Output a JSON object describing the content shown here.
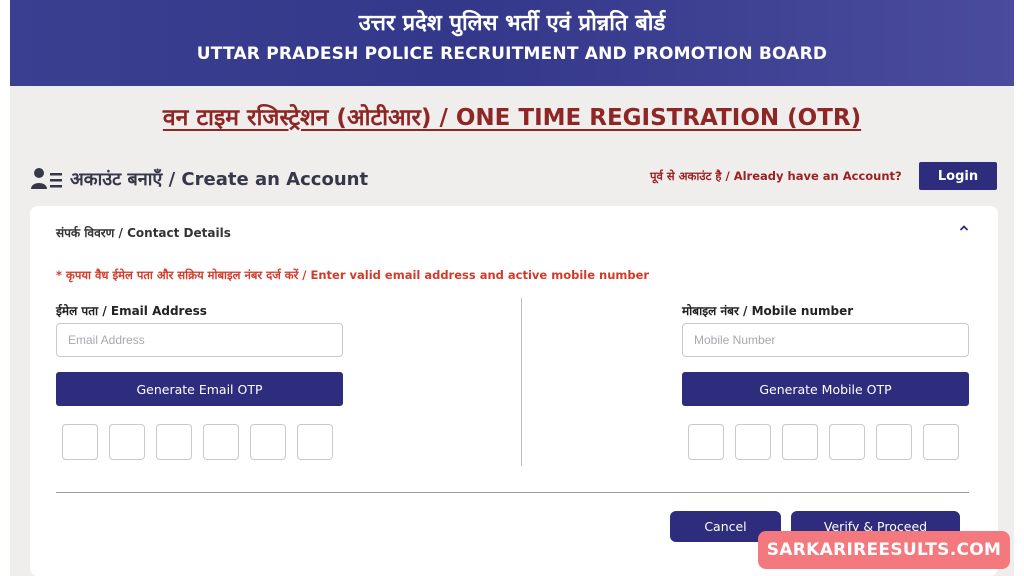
{
  "header": {
    "title_hindi": "उत्तर प्रदेश पुलिस भर्ती एवं प्रोन्नति बोर्ड",
    "title_english": "UTTAR PRADESH POLICE RECRUITMENT AND PROMOTION BOARD",
    "bg_color": "#3b3f90"
  },
  "page_title": "वन टाइम रजिस्ट्रेशन (ओटीआर) / ONE TIME REGISTRATION (OTR)",
  "account": {
    "create_label": "अकाउंट बनाएँ / Create an Account",
    "create_icon": "user-list-icon",
    "already_text": "पूर्व से अकाउंट है / Already have an Account?",
    "login_label": "Login"
  },
  "contact": {
    "section_title": "संपर्क विवरण / Contact Details",
    "collapse_icon": "chevron-up-icon",
    "note": "* कृपया वैध ईमेल पता और सक्रिय मोबाइल नंबर दर्ज करें / Enter valid email address and active mobile number",
    "email": {
      "label": "ईमेल पता / Email Address",
      "placeholder": "Email Address",
      "value": "",
      "otp_button": "Generate Email OTP",
      "otp_values": [
        "",
        "",
        "",
        "",
        "",
        ""
      ]
    },
    "mobile": {
      "label": "मोबाइल नंबर / Mobile number",
      "placeholder": "Mobile Number",
      "value": "",
      "otp_button": "Generate Mobile OTP",
      "otp_values": [
        "",
        "",
        "",
        "",
        "",
        ""
      ]
    }
  },
  "actions": {
    "cancel_label": "Cancel",
    "verify_label": "Verify & Proceed"
  },
  "watermark": "SARKARIREESULTS.COM",
  "colors": {
    "primary": "#2e2c7c",
    "title_red": "#8e2626",
    "note_red": "#d23b2a",
    "page_bg": "#efeeec"
  }
}
